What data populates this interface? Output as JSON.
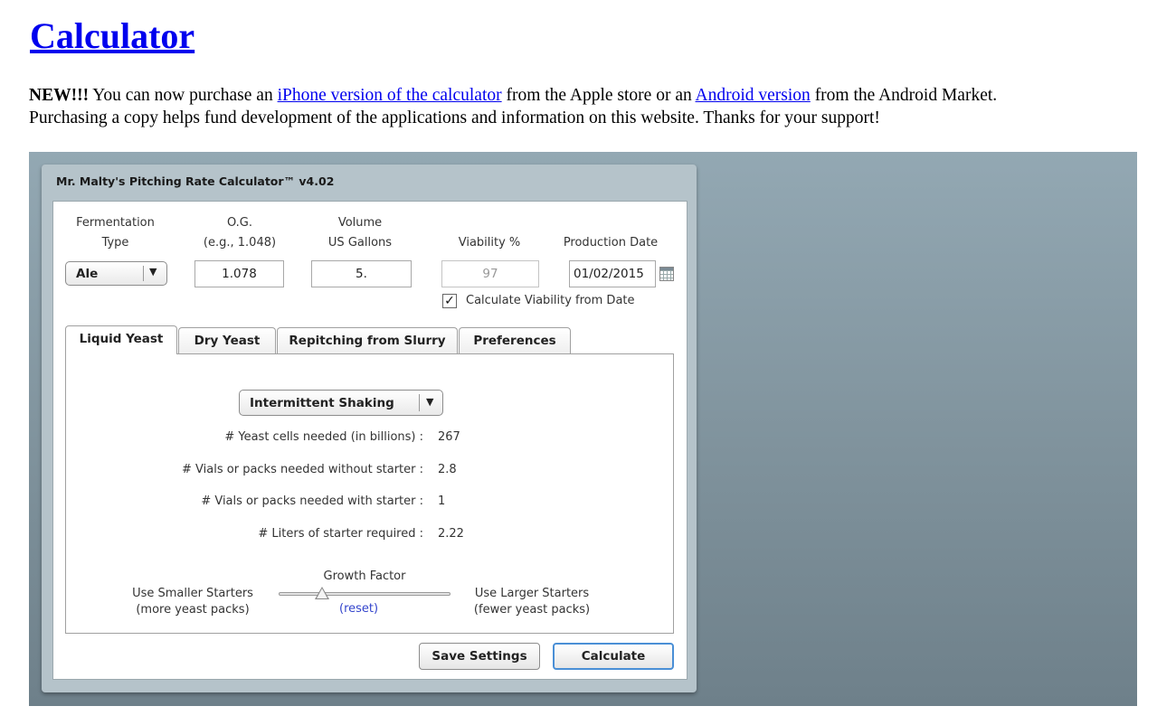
{
  "page": {
    "title": "Calculator",
    "intro": {
      "new_label": "NEW!!!",
      "text_1": " You can now purchase an ",
      "iphone_link": "iPhone version of the calculator",
      "text_2": " from the Apple store or an ",
      "android_link": "Android version",
      "text_3": " from the Android Market.",
      "line_2": "Purchasing a copy helps fund development of the applications and information on this website. Thanks for your support!"
    }
  },
  "calculator": {
    "title": "Mr. Malty's Pitching Rate Calculator™ v4.02",
    "labels": {
      "fermentation_1": "Fermentation",
      "fermentation_2": "Type",
      "og_1": "O.G.",
      "og_2": "(e.g., 1.048)",
      "volume_1": "Volume",
      "volume_2": "US Gallons",
      "viability": "Viability %",
      "production_date": "Production Date"
    },
    "fermentation_type": "Ale",
    "og": "1.078",
    "volume": "5.",
    "viability": "97",
    "production_date": "01/02/2015",
    "calc_viability_checked": true,
    "calc_viability_label": "Calculate Viability from Date",
    "tabs": [
      {
        "label": "Liquid Yeast",
        "active": true
      },
      {
        "label": "Dry Yeast",
        "active": false
      },
      {
        "label": "Repitching from Slurry",
        "active": false
      },
      {
        "label": "Preferences",
        "active": false
      }
    ],
    "aeration_method": "Intermittent Shaking",
    "results": [
      {
        "label": "# Yeast cells needed (in billions) :",
        "value": "267"
      },
      {
        "label": "# Vials or packs needed without starter :",
        "value": "2.8"
      },
      {
        "label": "# Vials or packs needed with starter :",
        "value": "1"
      },
      {
        "label": "# Liters of starter required :",
        "value": "2.22"
      }
    ],
    "growth_factor": {
      "label": "Growth Factor",
      "left_1": "Use Smaller Starters",
      "left_2": "(more yeast packs)",
      "right_1": "Use Larger Starters",
      "right_2": "(fewer yeast packs)",
      "reset": "(reset)",
      "level": 0.25
    },
    "buttons": {
      "save": "Save Settings",
      "calculate": "Calculate"
    }
  }
}
